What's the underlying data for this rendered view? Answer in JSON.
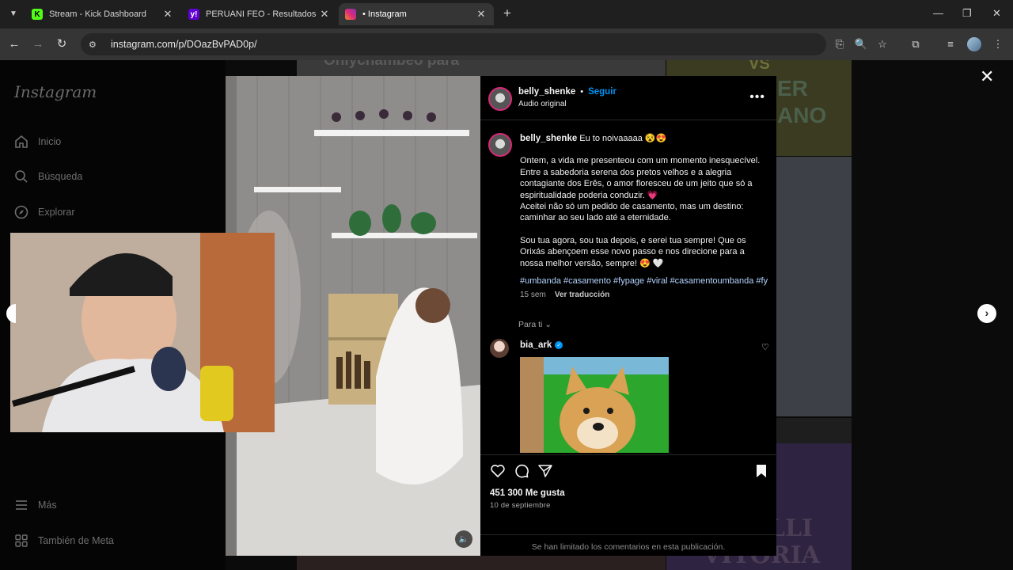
{
  "browser": {
    "tabs": [
      {
        "title": "Stream - Kick Dashboard",
        "favicon": "K"
      },
      {
        "title": "PERUANI FEO - Resultados de Y",
        "favicon": "y!"
      },
      {
        "title": "• Instagram",
        "favicon": "ig"
      }
    ],
    "url": "instagram.com/p/DOazBvPAD0p/"
  },
  "sidebar": {
    "logo": "Instagram",
    "items": [
      {
        "label": "Inicio",
        "icon": "home-icon"
      },
      {
        "label": "Búsqueda",
        "icon": "search-icon"
      },
      {
        "label": "Explorar",
        "icon": "compass-icon"
      },
      {
        "label": "Más",
        "icon": "menu-icon"
      },
      {
        "label": "También de Meta",
        "icon": "meta-grid-icon"
      }
    ]
  },
  "background_feed": {
    "texts": [
      "Onlychambeo para",
      "VS",
      "ER",
      "ANO",
      "ELLI",
      "VITORIA"
    ]
  },
  "post": {
    "username": "belly_shenke",
    "follow": "Seguir",
    "separator": "•",
    "audio": "Audio original",
    "caption_title": "Eu to noivaaaaa 😵😍",
    "caption_p1": "Ontem, a vida me presenteou com um momento inesquecível. Entre a sabedoria serena dos pretos velhos e a alegria contagiante dos Erês, o amor floresceu de um jeito que só a espiritualidade poderia conduzir. 💗",
    "caption_p1b": "Aceitei não só um pedido de casamento, mas um destino: caminhar ao seu lado até a eternidade.",
    "caption_p2": "Sou tua agora, sou tua depois, e serei tua sempre! Que os Orixás abençoem esse novo passo e nos direcione para a nossa melhor versão, sempre! 😍 🤍",
    "hashtags": "#umbanda #casamento #fypage #viral #casamentoumbanda #fy",
    "time_ago": "15 sem",
    "translate": "Ver traducción",
    "for_you": "Para ti",
    "comment_user": "bia_ark",
    "likes": "451 300 Me gusta",
    "date": "10 de septiembre",
    "comments_limited": "Se han limitado los comentarios en esta publicación."
  },
  "colors": {
    "accent_blue": "#0095f6",
    "bg": "#000000",
    "kick_green": "#53fc18",
    "yahoo_purple": "#6001d2"
  }
}
